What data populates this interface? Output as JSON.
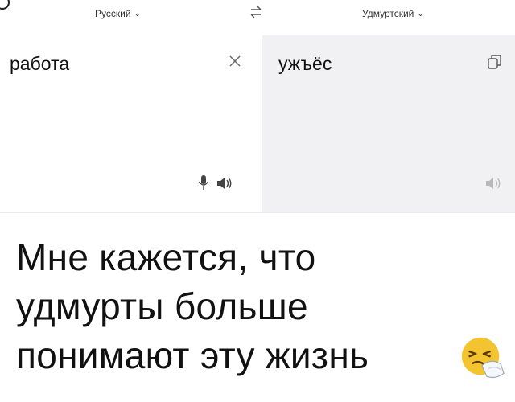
{
  "header": {
    "source_language": "Русский",
    "target_language": "Удмуртский",
    "chevron_icon": "chevron-down-icon",
    "swap_icon": "swap-arrows-icon"
  },
  "source_panel": {
    "text": "работа",
    "clear_icon": "close-icon",
    "mic_icon": "microphone-icon",
    "speaker_icon": "speaker-icon"
  },
  "target_panel": {
    "text": "ужъёс",
    "copy_icon": "copy-icon",
    "speaker_icon": "speaker-icon"
  },
  "caption": {
    "line1": "Мне кажется, что",
    "line2": "удмурты больше",
    "line3": "понимают эту жизнь"
  },
  "emoji": "sneezing-face-emoji",
  "colors": {
    "target_panel_bg": "#f1f1f4",
    "text": "#111111",
    "emoji_face": "#f4c430"
  }
}
